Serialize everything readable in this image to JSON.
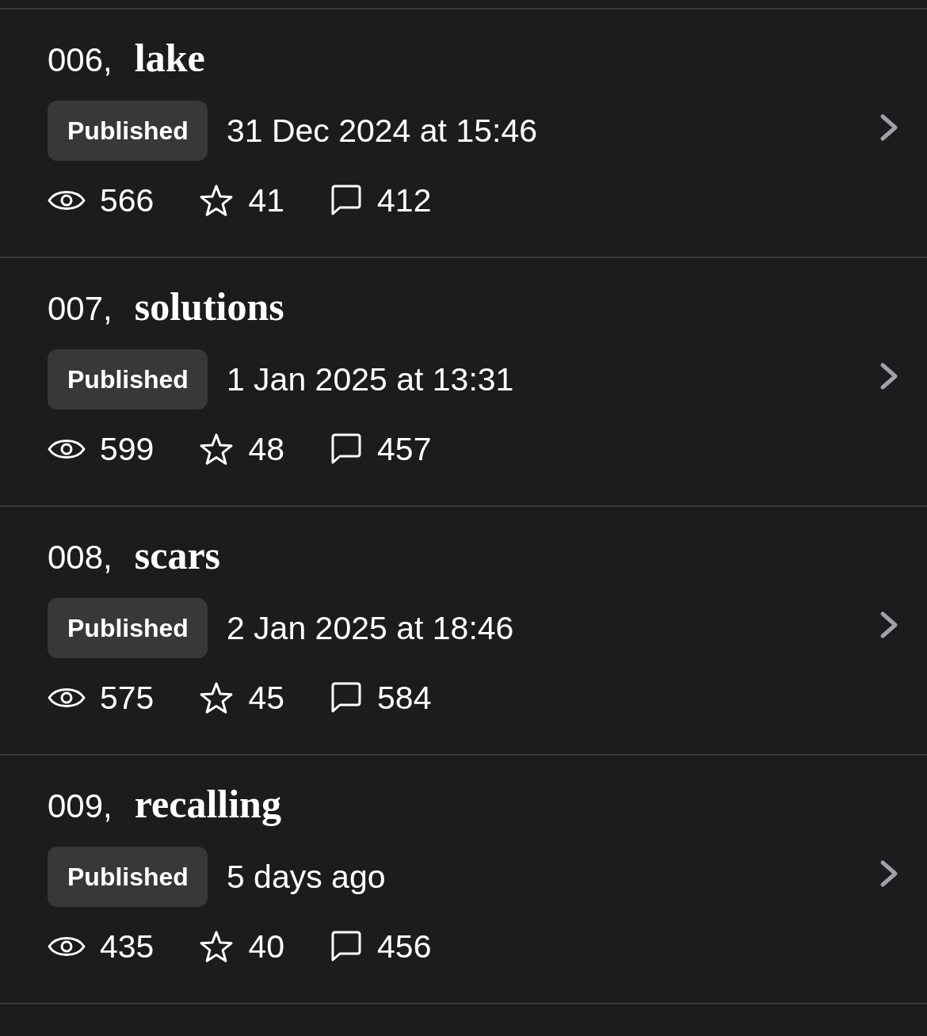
{
  "rows": [
    {
      "number": "006,",
      "title": "lake",
      "status": "Published",
      "date": "31 Dec 2024 at 15:46",
      "stats": [
        {
          "kind": "views",
          "value": "566"
        },
        {
          "kind": "stars",
          "value": "41"
        },
        {
          "kind": "comments",
          "value": "412"
        }
      ]
    },
    {
      "number": "007,",
      "title": "solutions",
      "status": "Published",
      "date": "1 Jan 2025 at 13:31",
      "stats": [
        {
          "kind": "views",
          "value": "599"
        },
        {
          "kind": "stars",
          "value": "48"
        },
        {
          "kind": "comments",
          "value": "457"
        }
      ]
    },
    {
      "number": "008,",
      "title": "scars",
      "status": "Published",
      "date": "2 Jan 2025 at 18:46",
      "stats": [
        {
          "kind": "views",
          "value": "575"
        },
        {
          "kind": "stars",
          "value": "45"
        },
        {
          "kind": "comments",
          "value": "584"
        }
      ]
    },
    {
      "number": "009,",
      "title": "recalling",
      "status": "Published",
      "date": "5 days ago",
      "stats": [
        {
          "kind": "views",
          "value": "435"
        },
        {
          "kind": "stars",
          "value": "40"
        },
        {
          "kind": "comments",
          "value": "456"
        }
      ]
    }
  ]
}
